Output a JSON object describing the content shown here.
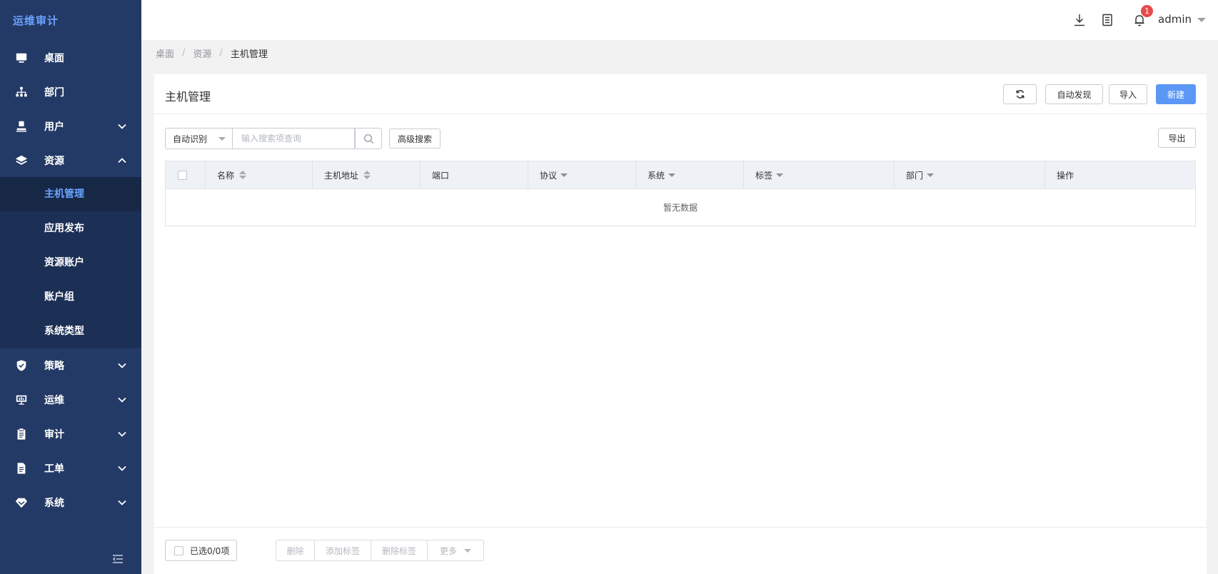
{
  "sidebar": {
    "brand": "运维审计",
    "menu": [
      {
        "label": "桌面",
        "icon": "monitor-icon"
      },
      {
        "label": "部门",
        "icon": "org-chart-icon"
      },
      {
        "label": "用户",
        "icon": "user-icon"
      },
      {
        "label": "资源",
        "icon": "layers-icon"
      },
      {
        "label": "策略",
        "icon": "shield-icon"
      },
      {
        "label": "运维",
        "icon": "presentation-icon"
      },
      {
        "label": "审计",
        "icon": "clipboard-icon"
      },
      {
        "label": "工单",
        "icon": "document-icon"
      },
      {
        "label": "系统",
        "icon": "diamond-icon"
      }
    ],
    "submenu": [
      "主机管理",
      "应用发布",
      "资源账户",
      "账户组",
      "系统类型"
    ]
  },
  "header": {
    "notification_count": "1",
    "username": "admin"
  },
  "breadcrumb": [
    "桌面",
    "资源",
    "主机管理"
  ],
  "breadcrumb_sep": "/",
  "page": {
    "title": "主机管理",
    "buttons": {
      "auto_discover": "自动发现",
      "import": "导入",
      "new": "新建",
      "advanced_search": "高级搜索",
      "export": "导出"
    }
  },
  "search": {
    "mode": "自动识别",
    "placeholder": "输入搜索项查询"
  },
  "table": {
    "columns": [
      "名称",
      "主机地址",
      "端口",
      "协议",
      "系统",
      "标签",
      "部门",
      "操作"
    ],
    "empty_text": "暂无数据"
  },
  "footer": {
    "selected": "已选0/0项",
    "actions": [
      "删除",
      "添加标签",
      "删除标签",
      "更多"
    ]
  },
  "colors": {
    "sidebar_bg": "#243a66",
    "submenu_bg": "#1c2f55",
    "accent": "#5b97f4",
    "brand": "#6aa3ff",
    "badge": "#e64b4b"
  }
}
